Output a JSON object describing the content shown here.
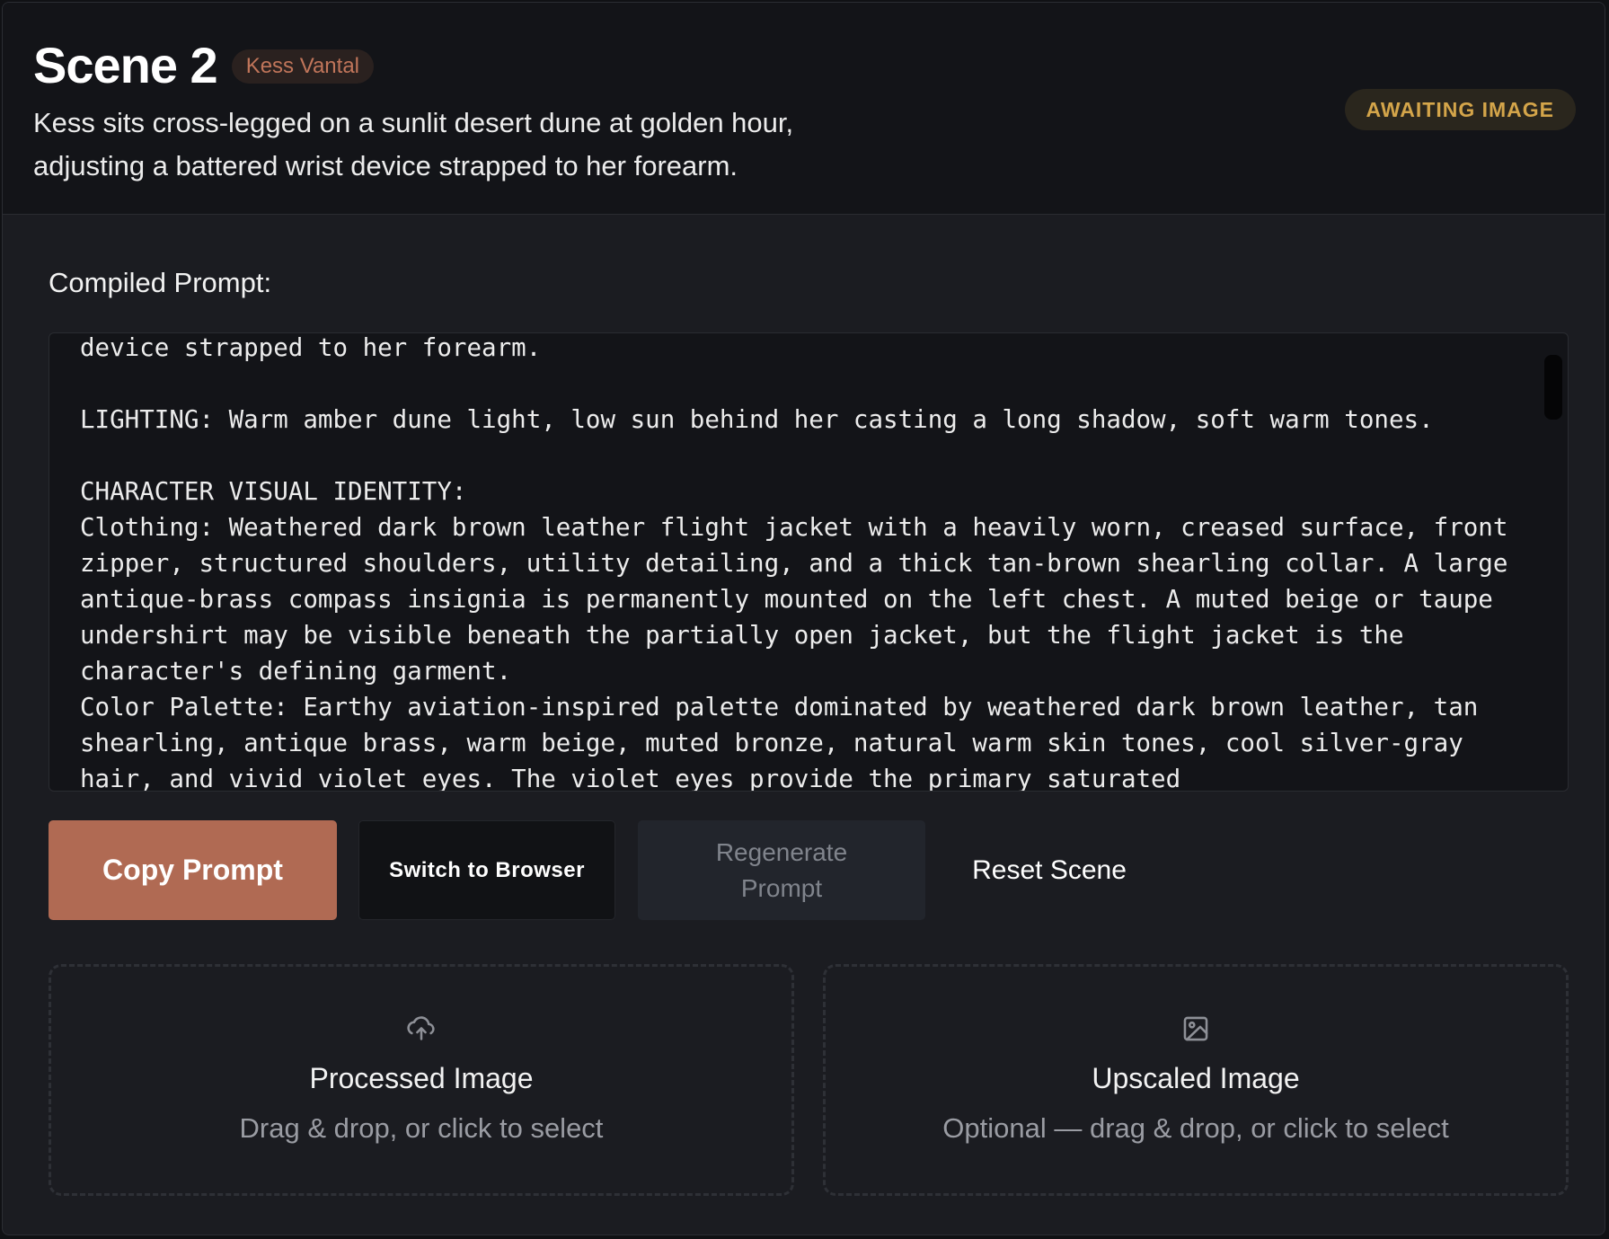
{
  "scene": {
    "title": "Scene 2",
    "character": "Kess Vantal",
    "description": "Kess sits cross-legged on a sunlit desert dune at golden hour, adjusting a battered wrist device strapped to her forearm.",
    "status": "AWAITING IMAGE"
  },
  "prompt": {
    "label": "Compiled Prompt:",
    "text": "device strapped to her forearm.\n\nLIGHTING: Warm amber dune light, low sun behind her casting a long shadow, soft warm tones.\n\nCHARACTER VISUAL IDENTITY:\nClothing: Weathered dark brown leather flight jacket with a heavily worn, creased surface, front zipper, structured shoulders, utility detailing, and a thick tan-brown shearling collar. A large antique-brass compass insignia is permanently mounted on the left chest. A muted beige or taupe undershirt may be visible beneath the partially open jacket, but the flight jacket is the character's defining garment.\nColor Palette: Earthy aviation-inspired palette dominated by weathered dark brown leather, tan shearling, antique brass, warm beige, muted bronze, natural warm skin tones, cool silver-gray hair, and vivid violet eyes. The violet eyes provide the primary saturated"
  },
  "actions": {
    "copy": "Copy Prompt",
    "switch": "Switch to Browser",
    "regenerate": "Regenerate Prompt",
    "reset": "Reset Scene"
  },
  "uploads": {
    "processed": {
      "icon": "upload-cloud-icon",
      "title": "Processed Image",
      "hint": "Drag & drop, or click to select"
    },
    "upscaled": {
      "icon": "image-icon",
      "title": "Upscaled Image",
      "hint": "Optional — drag & drop, or click to select"
    }
  },
  "colors": {
    "accent": "#b06a53",
    "status": "#d4a54a",
    "character_badge": "#c0755a"
  }
}
